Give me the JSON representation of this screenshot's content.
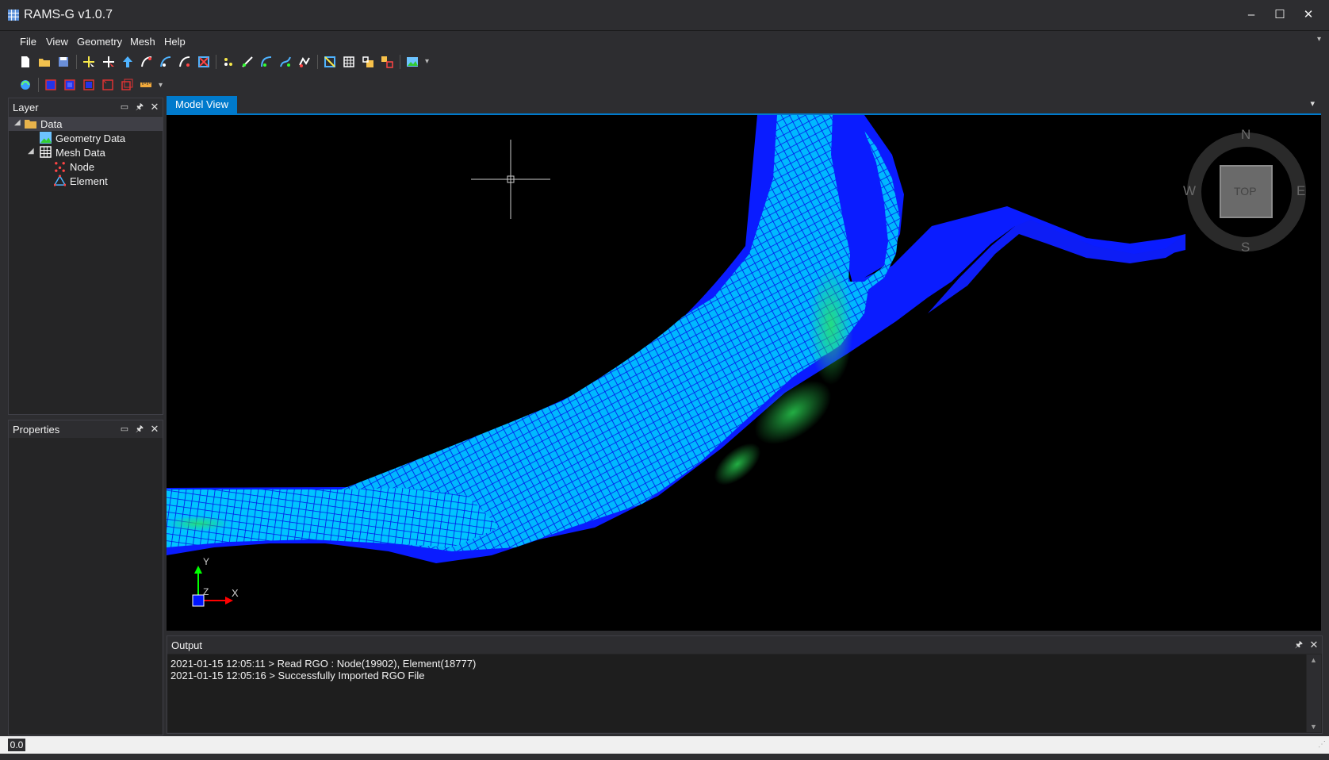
{
  "window": {
    "title": "RAMS-G v1.0.7",
    "minimize": "–",
    "maximize": "☐",
    "close": "✕"
  },
  "menu": [
    "File",
    "View",
    "Geometry",
    "Mesh",
    "Help"
  ],
  "layer_panel": {
    "title": "Layer",
    "tree": {
      "root": "Data",
      "geometry": "Geometry Data",
      "mesh": "Mesh Data",
      "node": "Node",
      "element": "Element"
    }
  },
  "properties_panel": {
    "title": "Properties"
  },
  "viewport": {
    "tab": "Model View",
    "compass": {
      "n": "N",
      "s": "S",
      "e": "E",
      "w": "W",
      "cube": "TOP"
    },
    "axes": {
      "x": "X",
      "y": "Y",
      "z": "Z"
    }
  },
  "output_panel": {
    "title": "Output",
    "lines": [
      "2021-01-15 12:05:11 > Read RGO : Node(19902), Element(18777)",
      "2021-01-15 12:05:16 > Successfully Imported RGO File"
    ]
  },
  "status": {
    "text": "0.0"
  },
  "colors": {
    "accent": "#007acc",
    "mesh_blue": "#0a1cff",
    "mesh_cyan": "#00d7ff",
    "mesh_green": "#1fd75a"
  }
}
